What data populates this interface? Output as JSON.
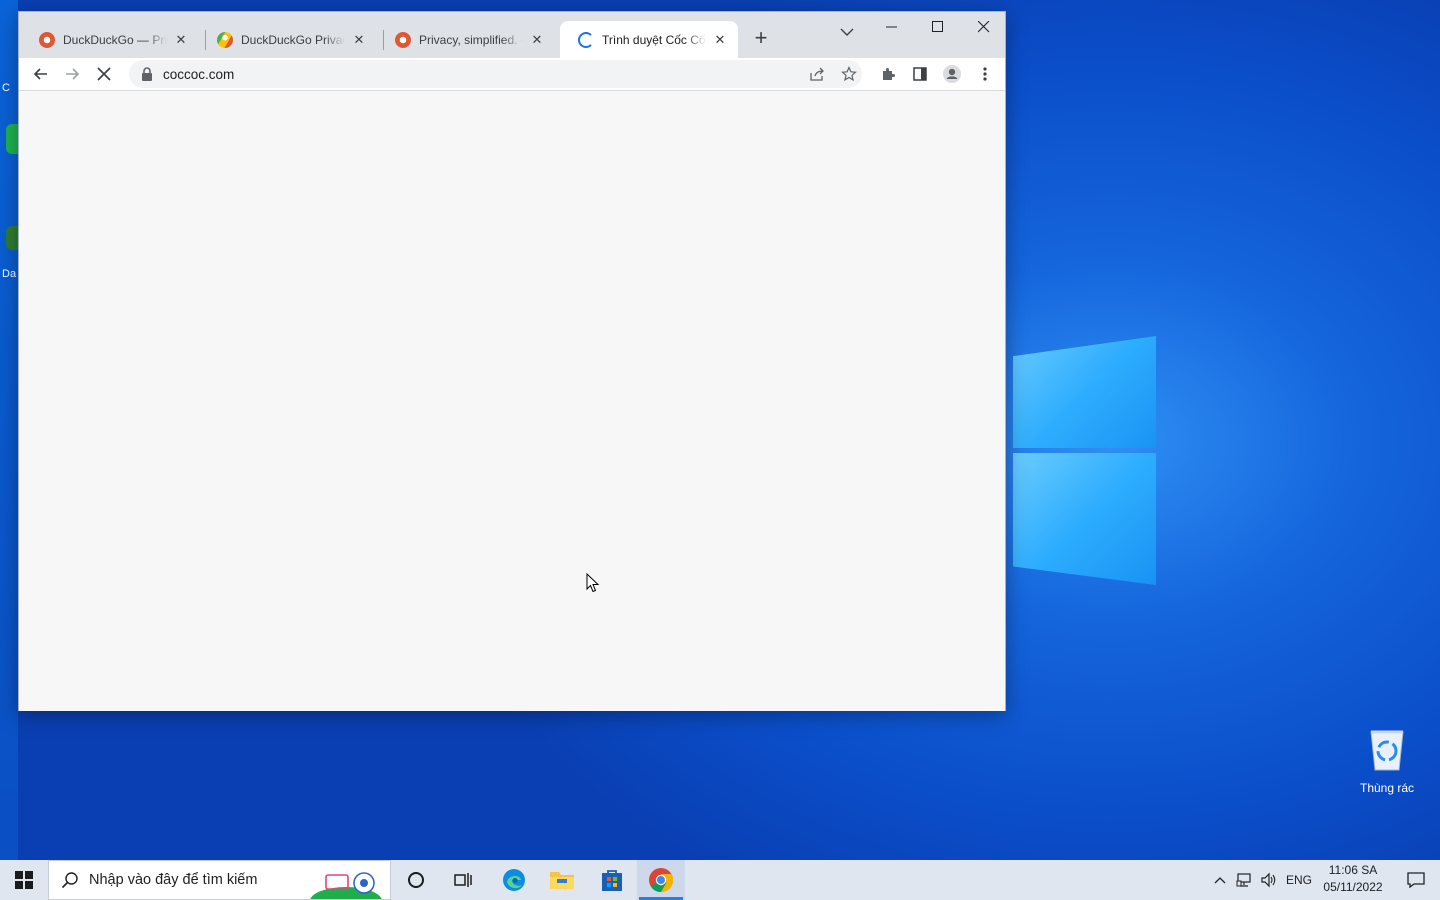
{
  "desktop": {
    "partial_icon_labels": [
      "C",
      "Da"
    ],
    "recycle_bin_label": "Thùng rác"
  },
  "browser": {
    "tabs": [
      {
        "title": "DuckDuckGo — Privacy",
        "favicon": "duckduckgo-icon",
        "active": false
      },
      {
        "title": "DuckDuckGo Privacy",
        "favicon": "duckduckgo-browser-icon",
        "active": false
      },
      {
        "title": "Privacy, simplified. —",
        "favicon": "duckduckgo-icon",
        "active": false
      },
      {
        "title": "Trình duyệt Cốc Cốc |",
        "favicon": "loading-spinner-icon",
        "active": true
      }
    ],
    "new_tab_label": "+",
    "address": {
      "url": "coccoc.com"
    },
    "colors": {
      "tabstrip": "#dee1e6",
      "content": "#f7f7f7",
      "accent": "#1a73e8"
    }
  },
  "taskbar": {
    "search_placeholder": "Nhập vào đây để tìm kiếm",
    "tray_language": "ENG",
    "clock_time": "11:06 SA",
    "clock_date": "05/11/2022",
    "accent": "#2a7de1"
  }
}
